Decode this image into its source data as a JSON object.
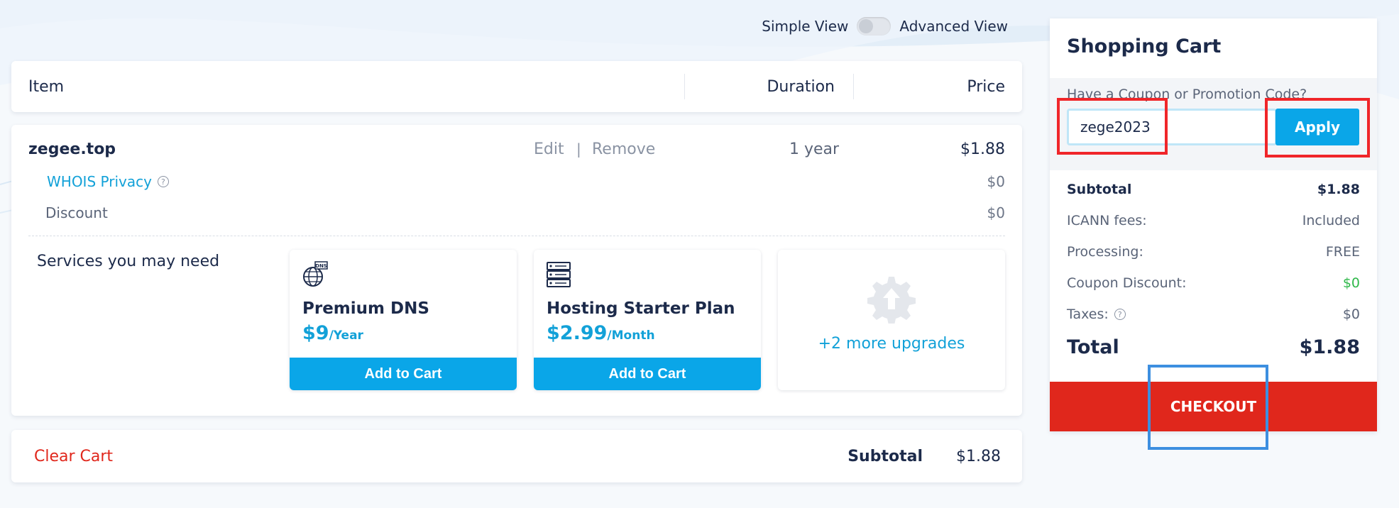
{
  "view_toggle": {
    "simple": "Simple View",
    "advanced": "Advanced View"
  },
  "table_header": {
    "item": "Item",
    "duration": "Duration",
    "price": "Price"
  },
  "line_item": {
    "domain": "zegee.top",
    "edit": "Edit",
    "separator": "|",
    "remove": "Remove",
    "duration": "1 year",
    "price": "$1.88",
    "whois_label": "WHOIS Privacy",
    "whois_price": "$0",
    "discount_label": "Discount",
    "discount_price": "$0"
  },
  "services": {
    "title": "Services you may need",
    "cards": [
      {
        "name": "Premium DNS",
        "price": "$9",
        "period": "/Year",
        "button": "Add to Cart",
        "icon": "dns-globe-icon"
      },
      {
        "name": "Hosting Starter Plan",
        "price": "$2.99",
        "period": "/Month",
        "button": "Add to Cart",
        "icon": "server-icon"
      }
    ],
    "more": "+2 more upgrades"
  },
  "footer": {
    "clear_cart": "Clear Cart",
    "subtotal_label": "Subtotal",
    "subtotal_value": "$1.88"
  },
  "cart": {
    "title": "Shopping Cart",
    "coupon_label": "Have a Coupon or Promotion Code?",
    "coupon_value": "zege2023",
    "apply": "Apply",
    "rows": [
      {
        "label": "Subtotal",
        "value": "$1.88"
      },
      {
        "label": "ICANN fees:",
        "value": "Included"
      },
      {
        "label": "Processing:",
        "value": "FREE"
      },
      {
        "label": "Coupon Discount:",
        "value": "$0"
      },
      {
        "label": "Taxes:",
        "value": "$0"
      }
    ],
    "total_label": "Total",
    "total_value": "$1.88",
    "checkout": "CHECKOUT"
  },
  "colors": {
    "accent": "#0aa6e8",
    "danger": "#e0271c",
    "success": "#2fb84a",
    "text": "#1c2a4a"
  }
}
